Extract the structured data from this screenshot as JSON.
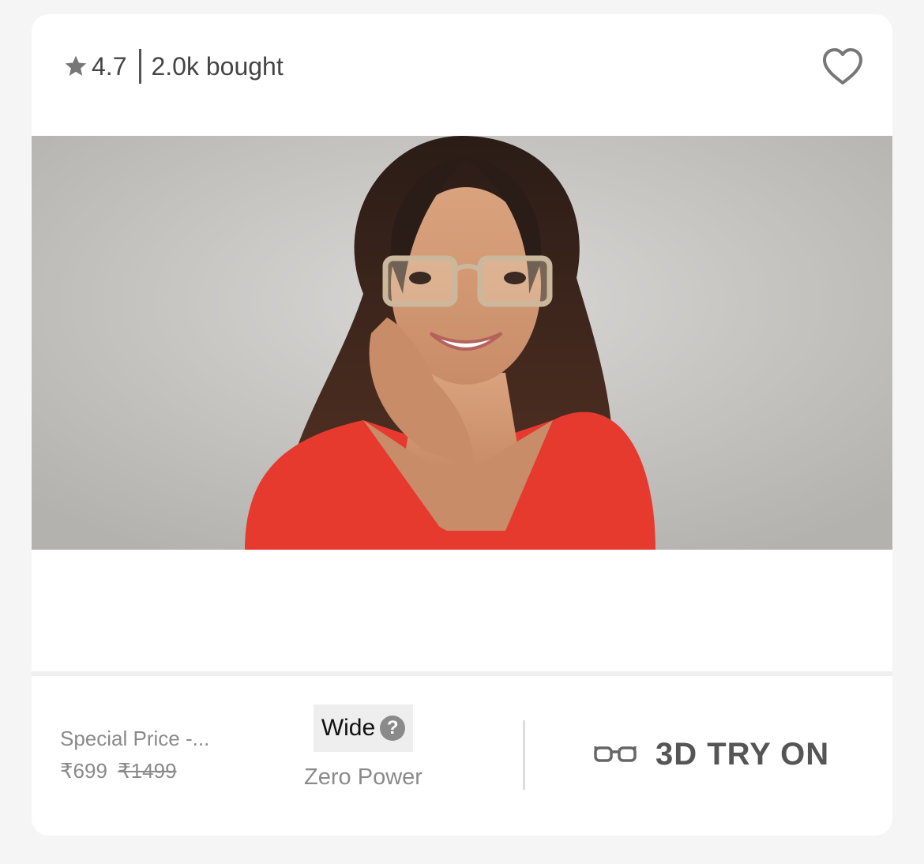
{
  "header": {
    "rating": "4.7",
    "bought_count": "2.0k bought",
    "star_icon": "star-icon",
    "wishlist_icon": "heart-outline-icon"
  },
  "product": {
    "image_alt": "Model wearing transparent square eyeglasses"
  },
  "pricing": {
    "label": "Special Price -...",
    "current_price": "₹699",
    "original_price": "₹1499"
  },
  "frame": {
    "width_label": "Wide",
    "help_icon": "question-icon",
    "power_label": "Zero Power"
  },
  "tryon": {
    "label": "3D TRY ON",
    "icon": "glasses-icon"
  },
  "colors": {
    "background": "#f5f5f5",
    "card": "#ffffff",
    "text_gray": "#8a8a8a",
    "dress_red": "#e63a2e"
  }
}
